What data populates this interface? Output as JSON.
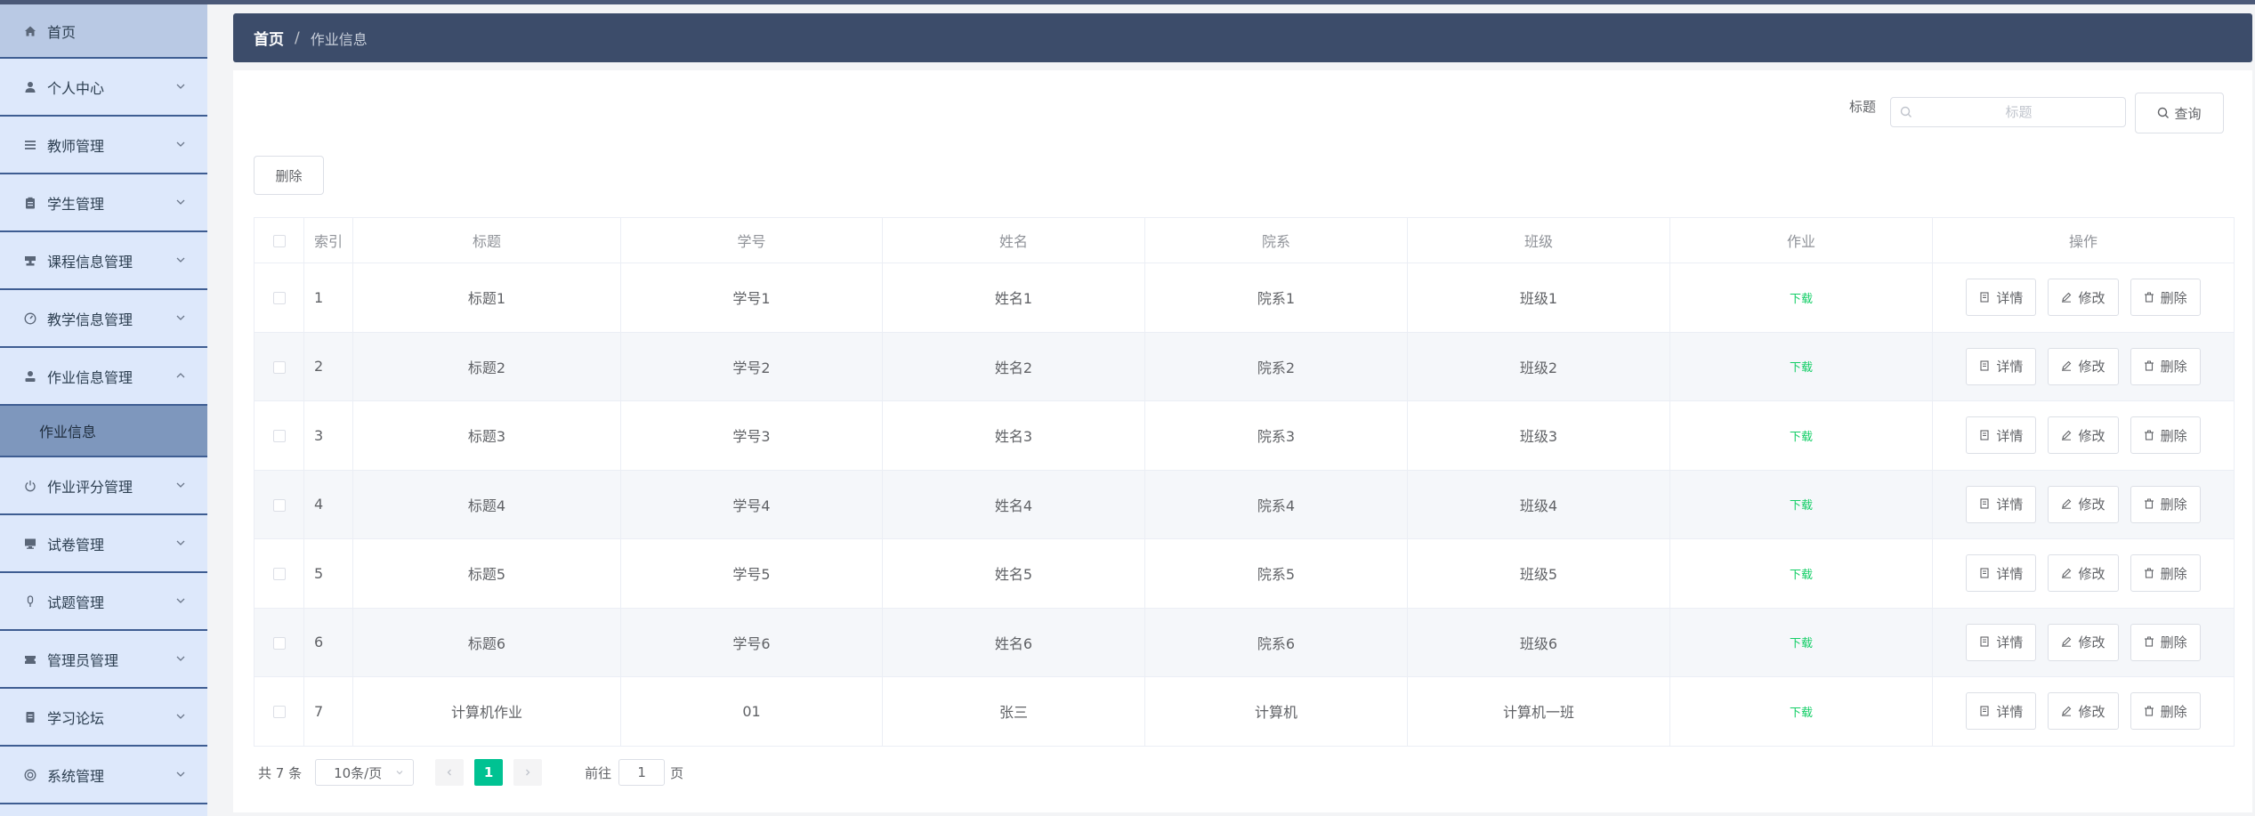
{
  "sidebar": {
    "items": [
      {
        "label": "首页",
        "icon": "home-icon"
      },
      {
        "label": "个人中心",
        "icon": "user-icon"
      },
      {
        "label": "教师管理",
        "icon": "list-icon"
      },
      {
        "label": "学生管理",
        "icon": "clipboard-icon"
      },
      {
        "label": "课程信息管理",
        "icon": "stamp-icon"
      },
      {
        "label": "教学信息管理",
        "icon": "gauge-icon"
      },
      {
        "label": "作业信息管理",
        "icon": "user-solid-icon"
      },
      {
        "label": "作业评分管理",
        "icon": "power-icon"
      },
      {
        "label": "试卷管理",
        "icon": "monitor-icon"
      },
      {
        "label": "试题管理",
        "icon": "mic-icon"
      },
      {
        "label": "管理员管理",
        "icon": "ticket-icon"
      },
      {
        "label": "学习论坛",
        "icon": "document-icon"
      },
      {
        "label": "系统管理",
        "icon": "circle-icon"
      }
    ],
    "submenu": {
      "label": "作业信息"
    }
  },
  "breadcrumb": {
    "home": "首页",
    "separator": "/",
    "current": "作业信息"
  },
  "search": {
    "label": "标题",
    "placeholder": "标题",
    "value": "",
    "button": "查询"
  },
  "toolbar": {
    "delete_label": "删除"
  },
  "table": {
    "headers": {
      "index": "索引",
      "title": "标题",
      "student_no": "学号",
      "name": "姓名",
      "department": "院系",
      "class": "班级",
      "homework": "作业",
      "actions": "操作"
    },
    "download_label": "下载",
    "detail_label": "详情",
    "edit_label": "修改",
    "delete_label": "删除",
    "rows": [
      {
        "index": "1",
        "title": "标题1",
        "student_no": "学号1",
        "name": "姓名1",
        "department": "院系1",
        "class": "班级1"
      },
      {
        "index": "2",
        "title": "标题2",
        "student_no": "学号2",
        "name": "姓名2",
        "department": "院系2",
        "class": "班级2"
      },
      {
        "index": "3",
        "title": "标题3",
        "student_no": "学号3",
        "name": "姓名3",
        "department": "院系3",
        "class": "班级3"
      },
      {
        "index": "4",
        "title": "标题4",
        "student_no": "学号4",
        "name": "姓名4",
        "department": "院系4",
        "class": "班级4"
      },
      {
        "index": "5",
        "title": "标题5",
        "student_no": "学号5",
        "name": "姓名5",
        "department": "院系5",
        "class": "班级5"
      },
      {
        "index": "6",
        "title": "标题6",
        "student_no": "学号6",
        "name": "姓名6",
        "department": "院系6",
        "class": "班级6"
      },
      {
        "index": "7",
        "title": "计算机作业",
        "student_no": "01",
        "name": "张三",
        "department": "计算机",
        "class": "计算机一班"
      }
    ]
  },
  "pagination": {
    "total": "共 7 条",
    "page_size": "10条/页",
    "current_page": "1",
    "goto_prefix": "前往",
    "goto_value": "1",
    "goto_suffix": "页"
  },
  "colors": {
    "accent": "#00c292",
    "header_bar": "#3c4c6a",
    "sidebar_bg": "#dde8fb",
    "sidebar_active": "#7e97bd",
    "download": "#13ce66"
  }
}
